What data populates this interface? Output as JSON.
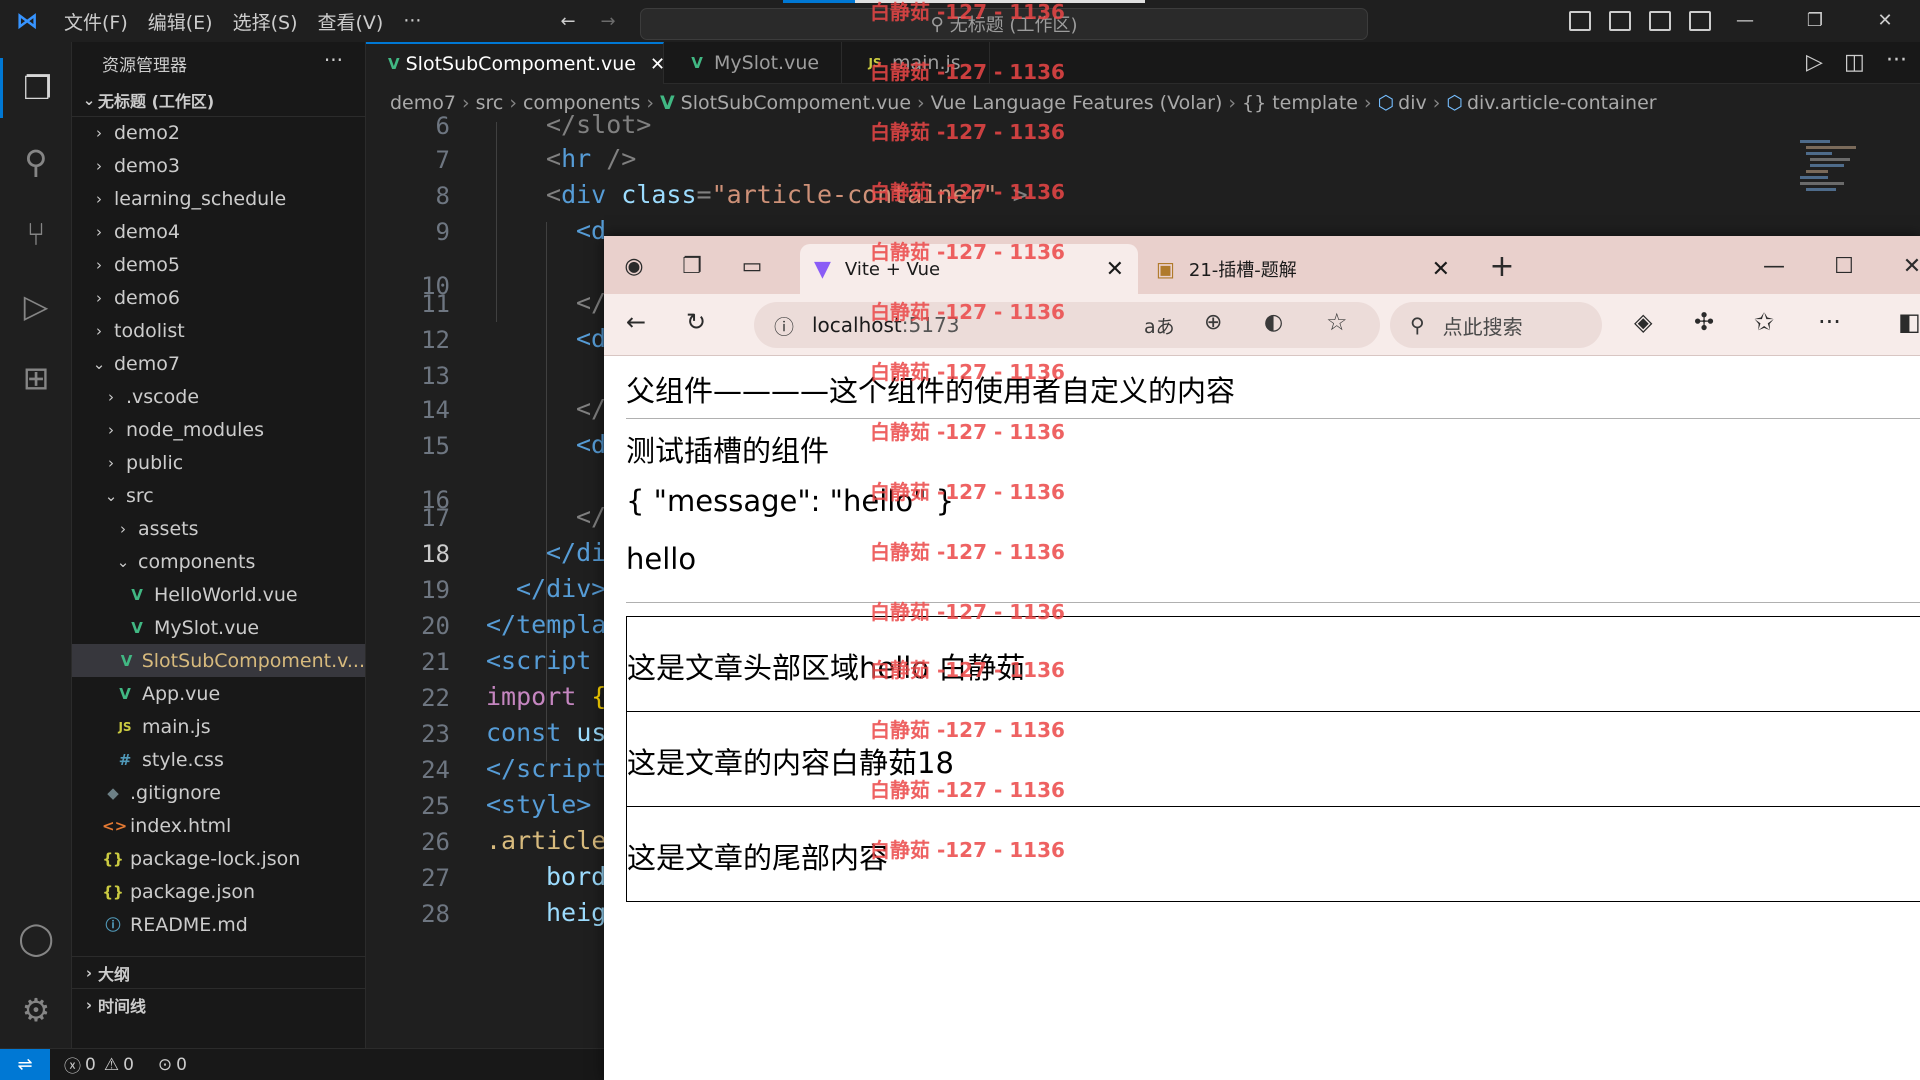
{
  "titlebar": {
    "menus": [
      "文件(F)",
      "编辑(E)",
      "选择(S)",
      "查看(V)",
      "···"
    ],
    "command_center": "无标题 (工作区)"
  },
  "sidebar": {
    "title": "资源管理器",
    "workspace": "无标题 (工作区)",
    "items": [
      {
        "label": "demo2",
        "chev": "›"
      },
      {
        "label": "demo3",
        "chev": "›"
      },
      {
        "label": "learning_schedule",
        "chev": "›"
      },
      {
        "label": "demo4",
        "chev": "›"
      },
      {
        "label": "demo5",
        "chev": "›"
      },
      {
        "label": "demo6",
        "chev": "›"
      },
      {
        "label": "todolist",
        "chev": "›"
      },
      {
        "label": "demo7",
        "chev": "⌄"
      },
      {
        "label": ".vscode",
        "chev": "›"
      },
      {
        "label": "node_modules",
        "chev": "›"
      },
      {
        "label": "public",
        "chev": "›"
      },
      {
        "label": "src",
        "chev": "⌄"
      },
      {
        "label": "assets",
        "chev": "›"
      },
      {
        "label": "components",
        "chev": "⌄"
      },
      {
        "label": "HelloWorld.vue",
        "icon": "V"
      },
      {
        "label": "MySlot.vue",
        "icon": "V"
      },
      {
        "label": "SlotSubCompoment.v...",
        "icon": "V"
      },
      {
        "label": "App.vue",
        "icon": "V"
      },
      {
        "label": "main.js",
        "icon": "JS"
      },
      {
        "label": "style.css",
        "icon": "#"
      },
      {
        "label": ".gitignore",
        "icon": "◆"
      },
      {
        "label": "index.html",
        "icon": "<>"
      },
      {
        "label": "package-lock.json",
        "icon": "{}"
      },
      {
        "label": "package.json",
        "icon": "{}"
      },
      {
        "label": "README.md",
        "icon": "ⓘ"
      }
    ],
    "outline": "大纲",
    "timeline": "时间线"
  },
  "tabs": [
    {
      "label": "SlotSubCompoment.vue",
      "icon": "V"
    },
    {
      "label": "MySlot.vue",
      "icon": "V"
    },
    {
      "label": "main.js",
      "icon": "JS"
    }
  ],
  "breadcrumb": {
    "demo7": "demo7",
    "src": "src",
    "components": "components",
    "file": "SlotSubCompoment.vue",
    "lang": "Vue Language Features (Volar)",
    "template_icon": "{}",
    "template": "template",
    "div": "div",
    "container": "div.article-container"
  },
  "editor": {
    "line_numbers": [
      "6",
      "7",
      "8",
      "9",
      "10",
      "11",
      "12",
      "13",
      "14",
      "15",
      "16",
      "17",
      "18",
      "19",
      "20",
      "21",
      "22",
      "23",
      "24",
      "25",
      "26",
      "27",
      "28"
    ],
    "code": {
      "l6": "</slot>",
      "l7_open": "<",
      "l7_tag": "hr",
      "l7_close": " />",
      "l8_open": "<",
      "l8_tag": "div",
      "l8_attr": "class",
      "l8_eq": "=",
      "l8_val": "\"article-container\"",
      "l8_close": " >",
      "l9": "<d",
      "l11": "</",
      "l12": "<d",
      "l14": "</",
      "l15": "<d",
      "l17": "</",
      "l18": "</di",
      "l19": "</div>",
      "l20": "</templa",
      "l21": "<script",
      "l22_kw": "import",
      "l22_rest": " {",
      "l23_kw": "const",
      "l23_rest": " us",
      "l24": "</script",
      "l25": "<style>",
      "l26": ".article",
      "l27": "bord",
      "l28": "heig"
    }
  },
  "statusbar": {
    "errors": "0",
    "warnings": "0",
    "ports": "0"
  },
  "browser": {
    "tabs": [
      {
        "label": "Vite + Vue"
      },
      {
        "label": "21-插槽-题解"
      }
    ],
    "address_host": "localhost",
    "address_port": ":5173",
    "search_placeholder": "点此搜索",
    "page": {
      "line1": "父组件————这个组件的使用者自定义的内容",
      "line2": "测试插槽的组件",
      "line3": "{ \"message\": \"hello\" }",
      "line4": "hello",
      "box1": "这是文章头部区域hello 白静茹",
      "box2": "这是文章的内容白静茹18",
      "box3": "这是文章的尾部内容"
    }
  },
  "watermark": "白静茹 -127 - 1136"
}
